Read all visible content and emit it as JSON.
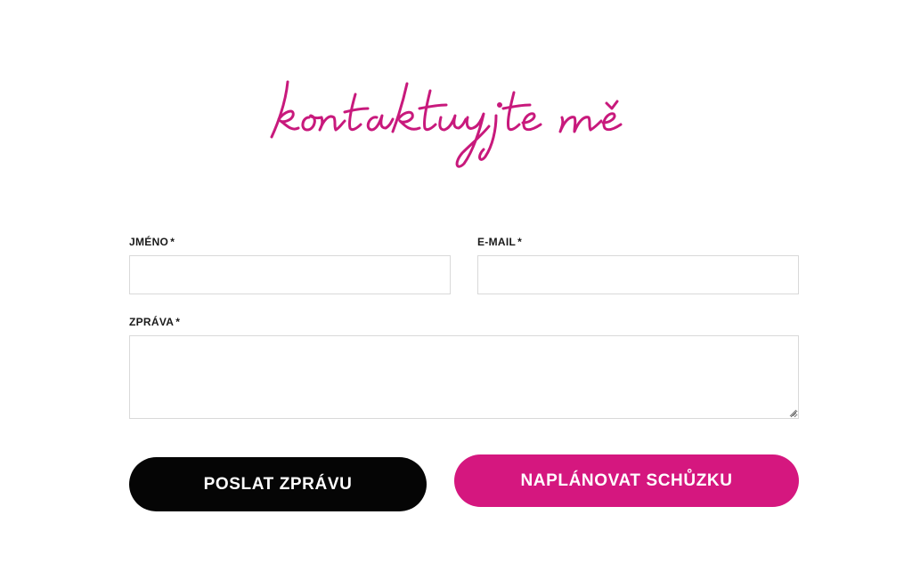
{
  "heading": {
    "text": "kontaktujte mě",
    "color": "#c8197c"
  },
  "form": {
    "name": {
      "label": "JMÉNO",
      "required_mark": "*",
      "value": ""
    },
    "email": {
      "label": "E-MAIL",
      "required_mark": "*",
      "value": ""
    },
    "message": {
      "label": "ZPRÁVA",
      "required_mark": "*",
      "value": ""
    }
  },
  "buttons": {
    "send_label": "POSLAT ZPRÁVU",
    "send_color": "#050505",
    "schedule_label": "NAPLÁNOVAT SCHŮZKU",
    "schedule_color": "#d5177f"
  }
}
